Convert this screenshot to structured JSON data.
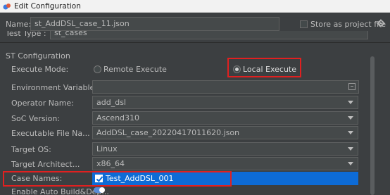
{
  "window": {
    "title": "Edit Configuration"
  },
  "name_row": {
    "label": "Name:",
    "value": "st_AddDSL_case_11.json",
    "store_label": "Store as project file",
    "store_checked": false
  },
  "test_type": {
    "label": "Test Type :",
    "value": "st_cases"
  },
  "section": {
    "title": "ST Configuration"
  },
  "execute_mode": {
    "label": "Execute Mode:",
    "options": [
      {
        "label": "Remote Execute",
        "selected": false
      },
      {
        "label": "Local Execute",
        "selected": true
      }
    ]
  },
  "env_vars": {
    "label": "Environment Variables:",
    "value": ""
  },
  "operator_name": {
    "label": "Operator Name:",
    "value": "add_dsl"
  },
  "soc_version": {
    "label": "SoC Version:",
    "value": "Ascend310"
  },
  "executable_file": {
    "label": "Executable File Na...",
    "value": "AddDSL_case_20220417011620.json"
  },
  "target_os": {
    "label": "Target OS:",
    "value": "Linux"
  },
  "target_arch": {
    "label": "Target Architect...",
    "value": "x86_64"
  },
  "case_names": {
    "label": "Case Names:",
    "value": "Test_AddDSL_001",
    "checked": true
  },
  "auto_build": {
    "label": "Enable Auto Build&Dep...",
    "enabled": true
  },
  "colors": {
    "background": "#3c3f41",
    "field": "#45494a",
    "selection": "#0d6bd6",
    "highlight": "#e02020"
  },
  "icons": [
    "app-icon",
    "gear-icon",
    "expand-icon",
    "chevron-down-icon"
  ]
}
